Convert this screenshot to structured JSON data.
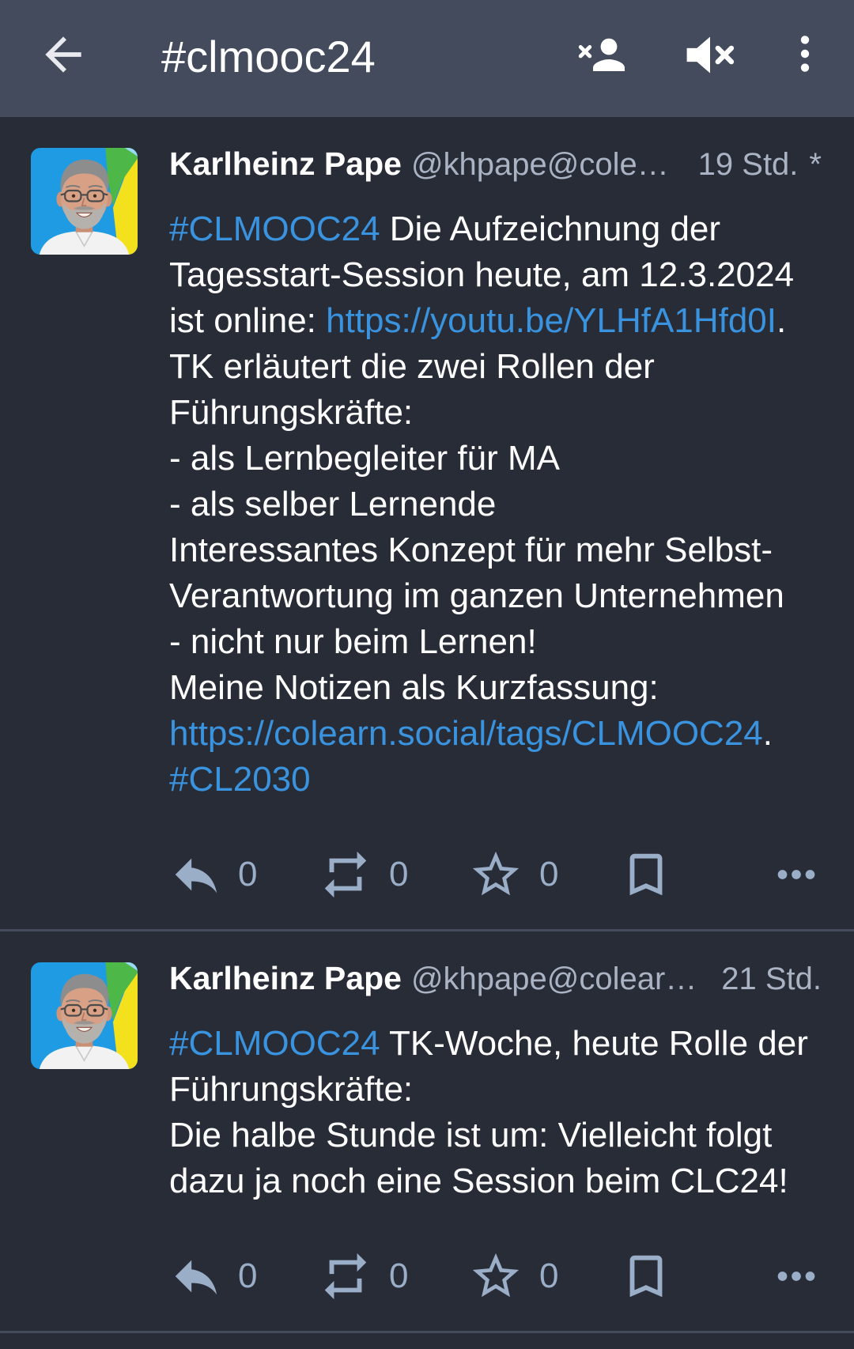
{
  "toolbar": {
    "title": "#clmooc24",
    "back_icon": "arrow-left-icon",
    "unfollow_icon": "unfollow-hashtag-icon",
    "mute_icon": "mute-icon",
    "menu_icon": "more-vertical-icon"
  },
  "colors": {
    "toolbar": "#444b5d",
    "background": "#282c37",
    "link": "#3a93de",
    "secondary_text": "#aab3c3",
    "icon": "#9baec8",
    "divider": "#444b5d"
  },
  "status_icons": {
    "reply": "reply-icon",
    "boost": "boost-icon",
    "favourite": "star-icon",
    "bookmark": "bookmark-icon",
    "more": "more-horizontal-icon"
  },
  "posts": [
    {
      "author": {
        "display_name": "Karlheinz Pape",
        "handle": "@khpape@cole…"
      },
      "timestamp": "19 Std.",
      "edited_marker": "*",
      "body_lines": [
        {
          "link": "#CLMOOC24",
          "after": " Die Aufzeichnung der"
        },
        {
          "text": "Tagesstart-Session heute, am 12.3.2024"
        },
        {
          "text": "ist online: ",
          "link": "https://youtu.be/YLHfA1Hfd0I",
          "after": "."
        },
        {
          "text": "TK erläutert die zwei Rollen der"
        },
        {
          "text": "Führungskräfte:"
        },
        {
          "text": "- als Lernbegleiter für MA"
        },
        {
          "text": "- als selber Lernende"
        },
        {
          "text": "Interessantes Konzept für mehr Selbst-"
        },
        {
          "text": "Verantwortung im ganzen Unternehmen"
        },
        {
          "text": "- nicht nur beim Lernen!"
        },
        {
          "text": "Meine Notizen als Kurzfassung:"
        },
        {
          "link": "https://colearn.social/tags/CLMOOC24",
          "after": "."
        },
        {
          "link": "#CL2030"
        }
      ],
      "actions": {
        "replies": 0,
        "boosts": 0,
        "favourites": 0
      }
    },
    {
      "author": {
        "display_name": "Karlheinz Pape",
        "handle": "@khpape@colear…"
      },
      "timestamp": "21 Std.",
      "body_lines": [
        {
          "link": "#CLMOOC24",
          "after": " TK-Woche, heute Rolle der"
        },
        {
          "text": "Führungskräfte:"
        },
        {
          "text": "Die halbe Stunde ist um: Vielleicht folgt"
        },
        {
          "text": "dazu ja noch eine Session beim CLC24!"
        }
      ],
      "actions": {
        "replies": 0,
        "boosts": 0,
        "favourites": 0
      }
    }
  ]
}
